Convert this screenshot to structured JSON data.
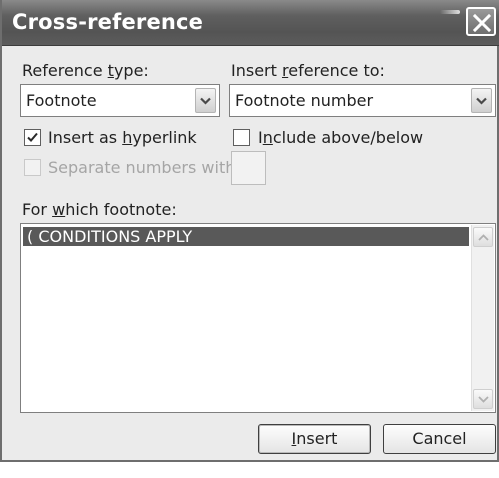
{
  "dialog": {
    "title": "Cross-reference",
    "close_icon": "close-icon"
  },
  "reference_type": {
    "label_pre": "Reference ",
    "label_key": "t",
    "label_post": "ype:",
    "value": "Footnote"
  },
  "insert_reference_to": {
    "label_pre": "Insert ",
    "label_key": "r",
    "label_post": "eference to:",
    "value": "Footnote number"
  },
  "insert_as_hyperlink": {
    "label_pre": "Insert as ",
    "label_key": "h",
    "label_post": "yperlink",
    "checked": true
  },
  "include_above_below": {
    "label_pre": "I",
    "label_key": "n",
    "label_post": "clude above/below",
    "checked": false
  },
  "separate_numbers": {
    "label": "Separate numbers with",
    "enabled": false,
    "checked": false
  },
  "footnote_list": {
    "label_pre": "For ",
    "label_key": "w",
    "label_post": "hich footnote:",
    "items": [
      {
        "text": "( CONDITIONS APPLY",
        "selected": true
      }
    ]
  },
  "buttons": {
    "insert_key": "I",
    "insert_rest": "nsert",
    "cancel": "Cancel"
  },
  "colors": {
    "titlebar": "#5c5c5c",
    "dialog_bg": "#ebebeb",
    "selection": "#595959"
  }
}
